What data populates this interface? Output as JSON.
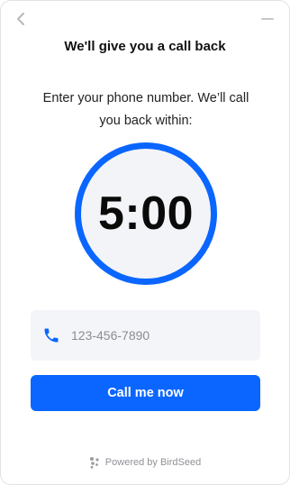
{
  "header": {
    "back_icon": "chevron-left-icon",
    "minimize_icon": "minimize-icon",
    "title": "We'll give you a call back"
  },
  "main": {
    "subtitle": "Enter your phone number. We’ll call you back within:",
    "timer": "5:00",
    "phone_icon": "phone-icon",
    "phone_placeholder": "123-456-7890",
    "phone_value": "",
    "call_button_label": "Call me now"
  },
  "footer": {
    "logo_icon": "birdseed-logo-icon",
    "powered_by": "Powered by BirdSeed"
  },
  "colors": {
    "accent": "#0a66ff",
    "field_background": "#f4f5f8",
    "ring_background": "#f3f4f7"
  }
}
